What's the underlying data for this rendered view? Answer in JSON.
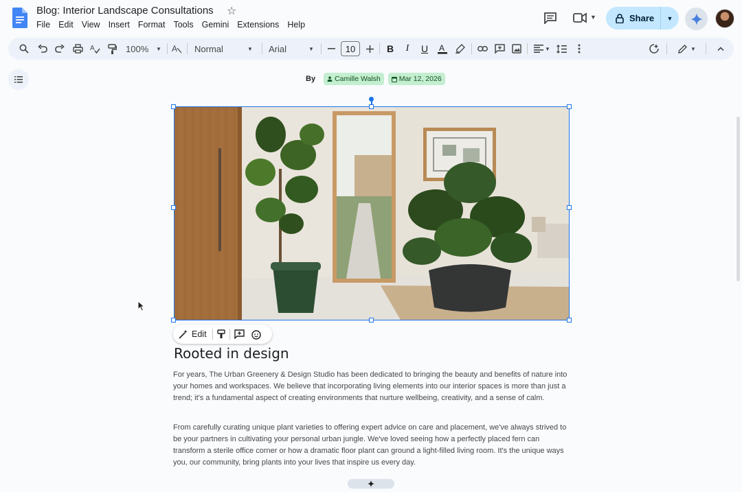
{
  "app": {
    "doc_title": "Blog: Interior Landscape Consultations",
    "menu": [
      "File",
      "Edit",
      "View",
      "Insert",
      "Format",
      "Tools",
      "Gemini",
      "Extensions",
      "Help"
    ],
    "share_label": "Share"
  },
  "toolbar": {
    "zoom": "100%",
    "style": "Normal",
    "font": "Arial",
    "font_size": "10"
  },
  "document": {
    "by_label": "By",
    "author_chip": "Camille Walsh",
    "date_chip": "Mar 12, 2026",
    "image_toolbar_edit": "Edit",
    "heading": "Rooted in design",
    "paragraph1": "For years, The Urban Greenery & Design Studio has been dedicated to bringing the beauty and benefits of nature into your homes and workspaces. We believe that incorporating living elements into our interior spaces is more than just a trend; it's a fundamental aspect of creating environments that nurture wellbeing, creativity, and a sense of calm.",
    "paragraph2": "From carefully curating unique plant varieties to offering expert advice on care and placement, we've always strived to be your partners in cultivating your personal urban jungle. We've loved seeing how a perfectly placed fern can transform a sterile office corner or how a dramatic floor plant can ground a light-filled living room. It's the unique ways you, our community, bring plants into your lives that inspire us every day."
  },
  "colors": {
    "accent_blue": "#1a73e8",
    "share_bg": "#c2e7ff",
    "chip_bg": "#c4eed0",
    "toolbar_bg": "#edf2fa"
  }
}
